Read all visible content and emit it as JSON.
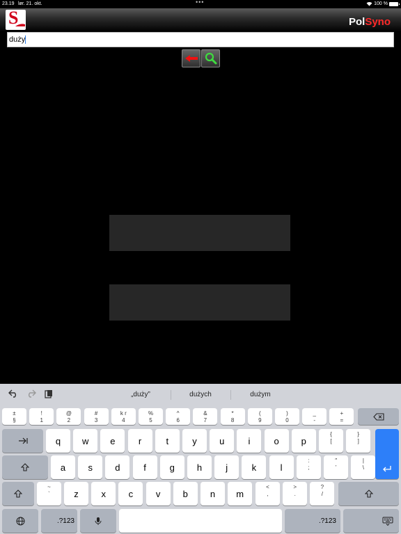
{
  "status_bar": {
    "time": "23.19",
    "date": "lør. 21. okt.",
    "battery": "100 %"
  },
  "app": {
    "name_part1": "Pol",
    "name_part2": "Syno",
    "logo_letter": "S"
  },
  "search": {
    "value": "duży"
  },
  "toolbar": {
    "clear_icon": "red-arrow-left-icon",
    "search_icon": "magnifier-icon"
  },
  "keyboard": {
    "suggestions": [
      "„duży”",
      "dużych",
      "dużym"
    ],
    "row1": [
      [
        "±",
        "§"
      ],
      [
        "!",
        "1"
      ],
      [
        "@",
        "2"
      ],
      [
        "#",
        "3"
      ],
      [
        "k r",
        "4"
      ],
      [
        "%",
        "5"
      ],
      [
        "^",
        "6"
      ],
      [
        "&",
        "7"
      ],
      [
        "*",
        "8"
      ],
      [
        "(",
        "9"
      ],
      [
        ")",
        "0"
      ],
      [
        "_",
        "-"
      ],
      [
        "+",
        "="
      ]
    ],
    "row2": [
      "q",
      "w",
      "e",
      "r",
      "t",
      "y",
      "u",
      "i",
      "o",
      "p"
    ],
    "row2_sym": [
      [
        "{",
        "["
      ],
      [
        "}",
        "]"
      ]
    ],
    "row3": [
      "a",
      "s",
      "d",
      "f",
      "g",
      "h",
      "j",
      "k",
      "l"
    ],
    "row3_sym": [
      [
        ":",
        ";"
      ],
      [
        "″",
        "’"
      ],
      [
        "|",
        "\\"
      ]
    ],
    "row4_sym": [
      [
        "~",
        "`"
      ]
    ],
    "row4": [
      "z",
      "x",
      "c",
      "v",
      "b",
      "n",
      "m"
    ],
    "row4_sym2": [
      [
        "<",
        ","
      ],
      [
        ">",
        "."
      ],
      [
        "?",
        "/"
      ]
    ],
    "num_label": ".?123",
    "icons": {
      "undo": "undo-icon",
      "redo": "redo-icon",
      "paste": "paste-icon",
      "delete": "delete-icon",
      "tab": "tab-icon",
      "shift": "shift-icon",
      "return": "return-icon",
      "globe": "globe-icon",
      "mic": "microphone-icon",
      "hide": "keyboard-hide-icon"
    }
  }
}
